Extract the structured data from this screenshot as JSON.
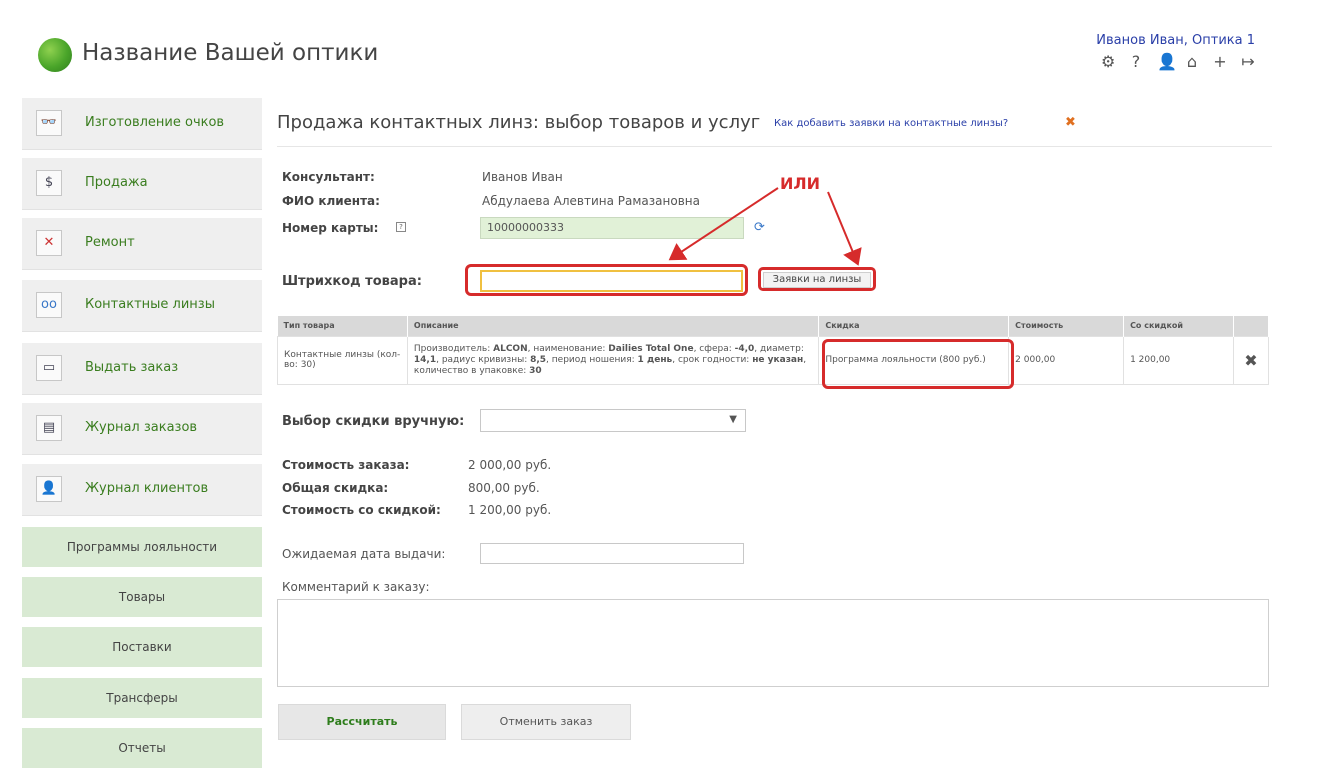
{
  "header": {
    "brand": "Название Вашей оптики",
    "user": "Иванов Иван, Оптика 1",
    "icons": [
      "gear-icon",
      "help-icon",
      "user-icon",
      "home-icon",
      "plus-icon",
      "logout-icon"
    ]
  },
  "sidebar": {
    "items": [
      {
        "label": "Изготовление очков",
        "icon": "glasses-icon"
      },
      {
        "label": "Продажа",
        "icon": "cash-icon"
      },
      {
        "label": "Ремонт",
        "icon": "repair-icon"
      },
      {
        "label": "Контактные линзы",
        "icon": "contact-lens-icon"
      },
      {
        "label": "Выдать заказ",
        "icon": "issue-order-icon"
      },
      {
        "label": "Журнал заказов",
        "icon": "orders-journal-icon"
      },
      {
        "label": "Журнал клиентов",
        "icon": "clients-journal-icon"
      }
    ],
    "secondary": [
      "Программы лояльности",
      "Товары",
      "Поставки",
      "Трансферы",
      "Отчеты"
    ]
  },
  "page": {
    "title": "Продажа контактных линз: выбор товаров и услуг",
    "help_link": "Как добавить заявки на контактные линзы?"
  },
  "form": {
    "consultant_label": "Консультант:",
    "consultant_value": "Иванов Иван",
    "client_label": "ФИО клиента:",
    "client_value": "Абдулаева Алевтина Рамазановна",
    "card_label": "Номер карты:",
    "card_value": "10000000333",
    "barcode_label": "Штрихкод товара:",
    "barcode_value": "",
    "orders_button": "Заявки на линзы",
    "annotation": "ИЛИ"
  },
  "table": {
    "headers": [
      "Тип товара",
      "Описание",
      "Скидка",
      "Стоимость",
      "Со скидкой"
    ],
    "row": {
      "type": "Контактные линзы (кол-во: 30)",
      "description_parts": [
        {
          "text": "Производитель: ",
          "b": false
        },
        {
          "text": "ALCON",
          "b": true
        },
        {
          "text": ", наименование: ",
          "b": false
        },
        {
          "text": "Dailies Total One",
          "b": true
        },
        {
          "text": ", сфера: ",
          "b": false
        },
        {
          "text": "-4,0",
          "b": true
        },
        {
          "text": ", диаметр: ",
          "b": false
        },
        {
          "text": "14,1",
          "b": true
        },
        {
          "text": ", радиус кривизны: ",
          "b": false
        },
        {
          "text": "8,5",
          "b": true
        },
        {
          "text": ", период ношения: ",
          "b": false
        },
        {
          "text": "1 день",
          "b": true
        },
        {
          "text": ", срок годности: ",
          "b": false
        },
        {
          "text": "не указан",
          "b": true
        },
        {
          "text": ", количество в упаковке: ",
          "b": false
        },
        {
          "text": "30",
          "b": true
        }
      ],
      "discount": "Программа лояльности (800 руб.)",
      "price": "2 000,00",
      "discounted": "1 200,00"
    }
  },
  "discount_select": {
    "label": "Выбор скидки вручную:",
    "value": ""
  },
  "totals": {
    "order_label": "Стоимость заказа:",
    "order_value": "2 000,00 руб.",
    "discount_label": "Общая скидка:",
    "discount_value": "800,00 руб.",
    "final_label": "Стоимость со скидкой:",
    "final_value": "1 200,00 руб."
  },
  "extra": {
    "date_label": "Ожидаемая дата выдачи:",
    "date_value": "",
    "comment_label": "Комментарий к заказу:",
    "comment_value": ""
  },
  "buttons": {
    "calculate": "Рассчитать",
    "cancel": "Отменить заказ"
  },
  "colors": {
    "brand_green": "#3a7d1f",
    "highlight_red": "#d62b2b",
    "link_blue": "#2a3fa8",
    "delete_orange": "#e07020"
  }
}
